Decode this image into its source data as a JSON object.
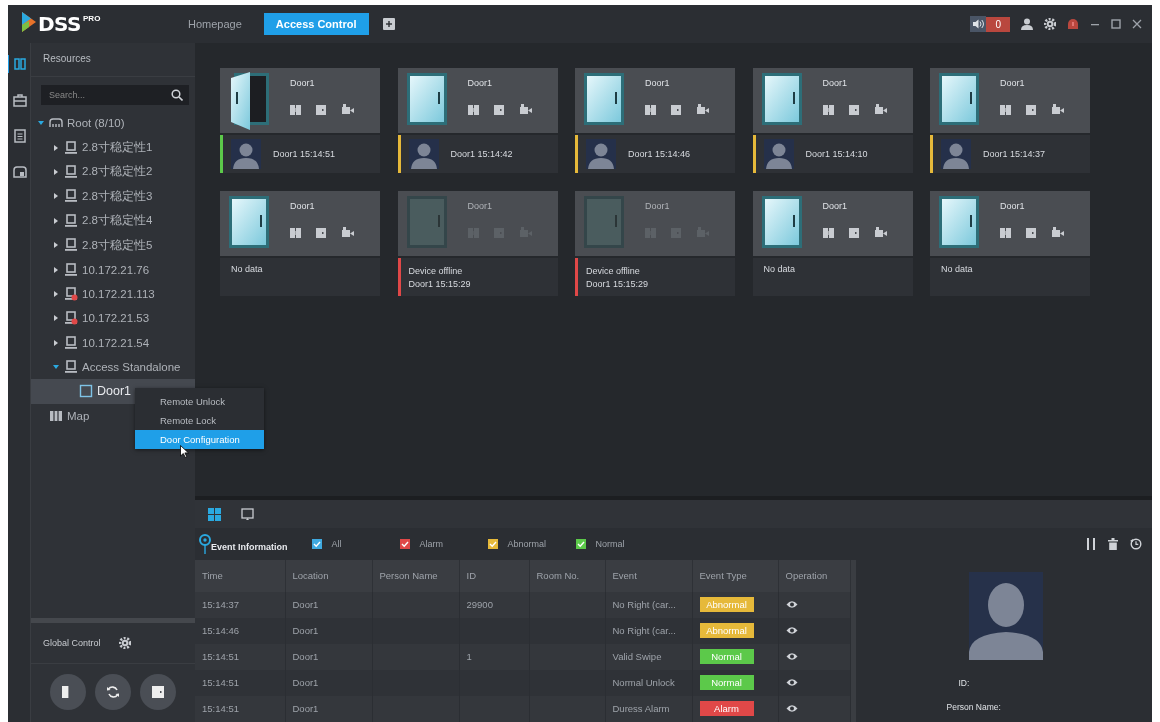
{
  "app": {
    "logo": "DSS",
    "logo_sup": "PRO"
  },
  "tabs": [
    {
      "label": "Homepage",
      "selected": false
    },
    {
      "label": "Access Control",
      "selected": true
    }
  ],
  "alarm_count": "0",
  "rail": [
    {
      "kind": "resources",
      "selected": true
    },
    {
      "kind": "toolbox",
      "selected": false
    },
    {
      "kind": "log",
      "selected": false
    },
    {
      "kind": "devices",
      "selected": false
    }
  ],
  "sidebar": {
    "title": "Resources",
    "search": {
      "placeholder": "Search..."
    },
    "tree": [
      {
        "label": "Root (8/10)",
        "kind": "root",
        "expanded": true,
        "selected": false,
        "children": [
          {
            "label": "2.8寸稳定性1",
            "kind": "device",
            "expanded": false,
            "offline": false,
            "selected": false
          },
          {
            "label": "2.8寸稳定性2",
            "kind": "device",
            "expanded": false,
            "offline": false,
            "selected": false
          },
          {
            "label": "2.8寸稳定性3",
            "kind": "device",
            "expanded": false,
            "offline": false,
            "selected": false
          },
          {
            "label": "2.8寸稳定性4",
            "kind": "device",
            "expanded": false,
            "offline": false,
            "selected": false
          },
          {
            "label": "2.8寸稳定性5",
            "kind": "device",
            "expanded": false,
            "offline": false,
            "selected": false
          },
          {
            "label": "10.172.21.76",
            "kind": "device",
            "expanded": false,
            "offline": false,
            "selected": false
          },
          {
            "label": "10.172.21.113",
            "kind": "device",
            "expanded": false,
            "offline": true,
            "selected": false
          },
          {
            "label": "10.172.21.53",
            "kind": "device",
            "expanded": false,
            "offline": true,
            "selected": false
          },
          {
            "label": "10.172.21.54",
            "kind": "device",
            "expanded": false,
            "offline": false,
            "selected": false
          },
          {
            "label": "Access Standalone",
            "kind": "device",
            "expanded": true,
            "offline": false,
            "selected": false,
            "children": [
              {
                "label": "Door1",
                "kind": "door",
                "selected": true
              }
            ]
          }
        ]
      },
      {
        "label": "Map",
        "kind": "map",
        "selected": false
      }
    ],
    "global_control": "Global Control"
  },
  "context_menu": [
    {
      "label": "Remote Unlock",
      "selected": false
    },
    {
      "label": "Remote Lock",
      "selected": false
    },
    {
      "label": "Door Configuration",
      "selected": true
    }
  ],
  "cards": [
    {
      "name": "Door1",
      "open": true,
      "offline": false,
      "event": {
        "color": "#5cc94a",
        "avatar": true,
        "lines": [
          "Door1 15:14:51"
        ]
      }
    },
    {
      "name": "Door1",
      "open": false,
      "offline": false,
      "event": {
        "color": "#e6b93a",
        "avatar": true,
        "lines": [
          "Door1 15:14:42"
        ]
      }
    },
    {
      "name": "Door1",
      "open": false,
      "offline": false,
      "event": {
        "color": "#e6b93a",
        "avatar": true,
        "lines": [
          "Door1 15:14:46"
        ]
      }
    },
    {
      "name": "Door1",
      "open": false,
      "offline": false,
      "event": {
        "color": "#e6b93a",
        "avatar": true,
        "lines": [
          "Door1 15:14:10"
        ]
      }
    },
    {
      "name": "Door1",
      "open": false,
      "offline": false,
      "event": {
        "color": "#e6b93a",
        "avatar": true,
        "lines": [
          "Door1 15:14:37"
        ]
      }
    },
    {
      "name": "Door1",
      "open": false,
      "offline": false,
      "event": {
        "avatar": false,
        "lines": [
          "No data"
        ]
      }
    },
    {
      "name": "Door1",
      "open": false,
      "offline": true,
      "event": {
        "color": "#e04848",
        "avatar": false,
        "lines": [
          "Device offline",
          "Door1 15:15:29"
        ]
      }
    },
    {
      "name": "Door1",
      "open": false,
      "offline": true,
      "event": {
        "color": "#e04848",
        "avatar": false,
        "lines": [
          "Device offline",
          "Door1 15:15:29"
        ]
      }
    },
    {
      "name": "Door1",
      "open": false,
      "offline": false,
      "event": {
        "avatar": false,
        "lines": [
          "No data"
        ]
      }
    },
    {
      "name": "Door1",
      "open": false,
      "offline": false,
      "event": {
        "avatar": false,
        "lines": [
          "No data"
        ]
      }
    }
  ],
  "view_tabs": [
    {
      "kind": "grid",
      "selected": true
    },
    {
      "kind": "screen",
      "selected": false
    }
  ],
  "events": {
    "title": "Event Information",
    "filters": [
      {
        "label": "All",
        "checked": true,
        "color": "#3fa9e0"
      },
      {
        "label": "Alarm",
        "checked": true,
        "color": "#e04848"
      },
      {
        "label": "Abnormal",
        "checked": true,
        "color": "#e6b93a"
      },
      {
        "label": "Normal",
        "checked": true,
        "color": "#5cc94a"
      }
    ],
    "columns": [
      "Time",
      "Location",
      "Person Name",
      "ID",
      "Room No.",
      "Event",
      "Event Type",
      "Operation"
    ],
    "rows": [
      {
        "time": "15:14:37",
        "location": "Door1",
        "id": "29900",
        "event": "No Right (car...",
        "type": {
          "label": "Abnormal",
          "kind": "abnormal"
        }
      },
      {
        "time": "15:14:46",
        "location": "Door1",
        "event": "No Right (car...",
        "type": {
          "label": "Abnormal",
          "kind": "abnormal"
        }
      },
      {
        "time": "15:14:51",
        "location": "Door1",
        "id": "1",
        "event": "Valid Swipe",
        "type": {
          "label": "Normal",
          "kind": "normal"
        }
      },
      {
        "time": "15:14:51",
        "location": "Door1",
        "event": "Normal Unlock",
        "type": {
          "label": "Normal",
          "kind": "normal"
        }
      },
      {
        "time": "15:14:51",
        "location": "Door1",
        "event": "Duress Alarm",
        "type": {
          "label": "Alarm",
          "kind": "alarm"
        }
      }
    ],
    "detail": {
      "id_label": "ID:",
      "name_label": "Person Name:"
    }
  }
}
